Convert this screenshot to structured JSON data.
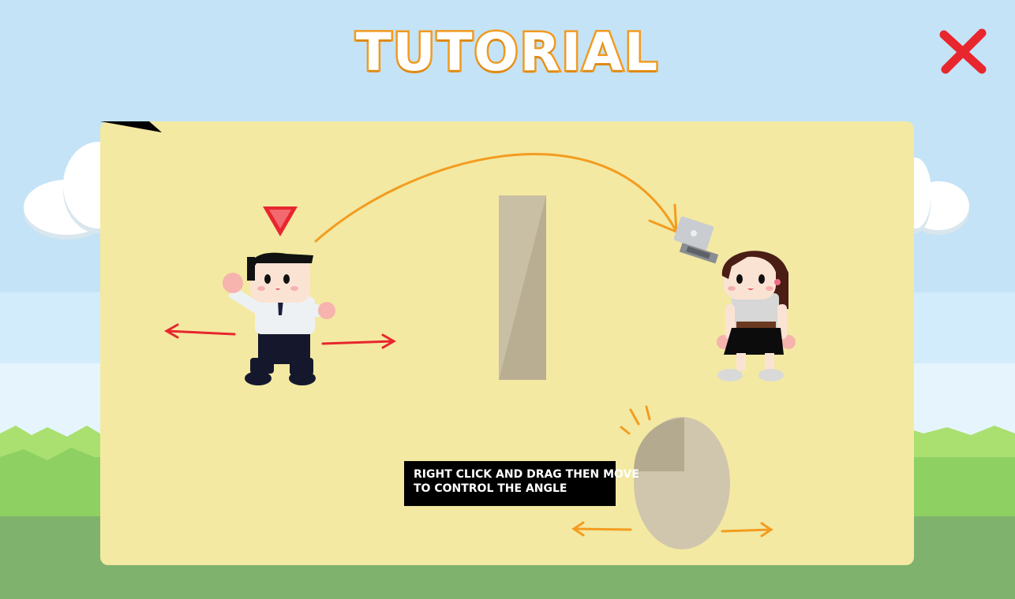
{
  "screen": {
    "title": "TUTORIAL",
    "close_icon": "close-x-icon",
    "colors": {
      "title_fill": "#ffffff",
      "title_stroke": "#f29a1f",
      "close": "#e8262e",
      "panel": "#f3e9a2",
      "arrow_red": "#e8262e",
      "arrow_orange": "#f39c20",
      "wall": "#c9bfa5"
    }
  },
  "tutorial": {
    "instruction_line1": "RIGHT CLICK AND DRAG THEN MOVE",
    "instruction_line2": "TO CONTROL THE ANGLE",
    "icons": {
      "player": "boy-character-icon",
      "target": "girl-character-icon",
      "projectile": "laptop-icon",
      "selector": "triangle-marker-icon",
      "mouse": "mouse-icon"
    }
  }
}
